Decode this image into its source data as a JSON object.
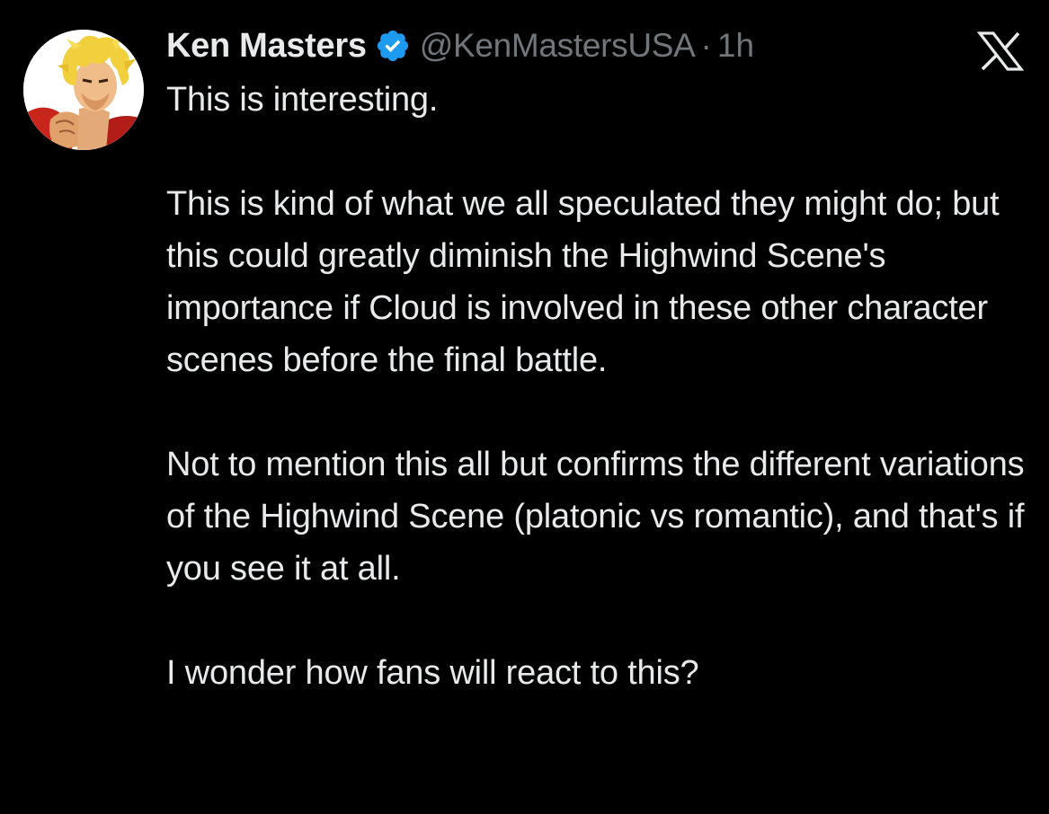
{
  "tweet": {
    "author": {
      "display_name": "Ken Masters",
      "handle": "@KenMastersUSA",
      "verified": true,
      "avatar": "ken-masters-avatar"
    },
    "separator": "·",
    "timestamp": "1h",
    "platform_logo": "x-logo-icon",
    "paragraphs": [
      "This is interesting.",
      "This is kind of what we all speculated they might do; but this could greatly diminish the Highwind Scene's importance if Cloud is involved in these other character scenes before the final battle.",
      "Not to mention this all but confirms the different variations of the Highwind Scene (platonic vs romantic), and that's if you see it at all.",
      "I wonder how fans will react to this?"
    ]
  },
  "colors": {
    "background": "#000000",
    "primary_text": "#e7e9ea",
    "secondary_text": "#71767b",
    "verified_badge": "#1d9bf0"
  }
}
